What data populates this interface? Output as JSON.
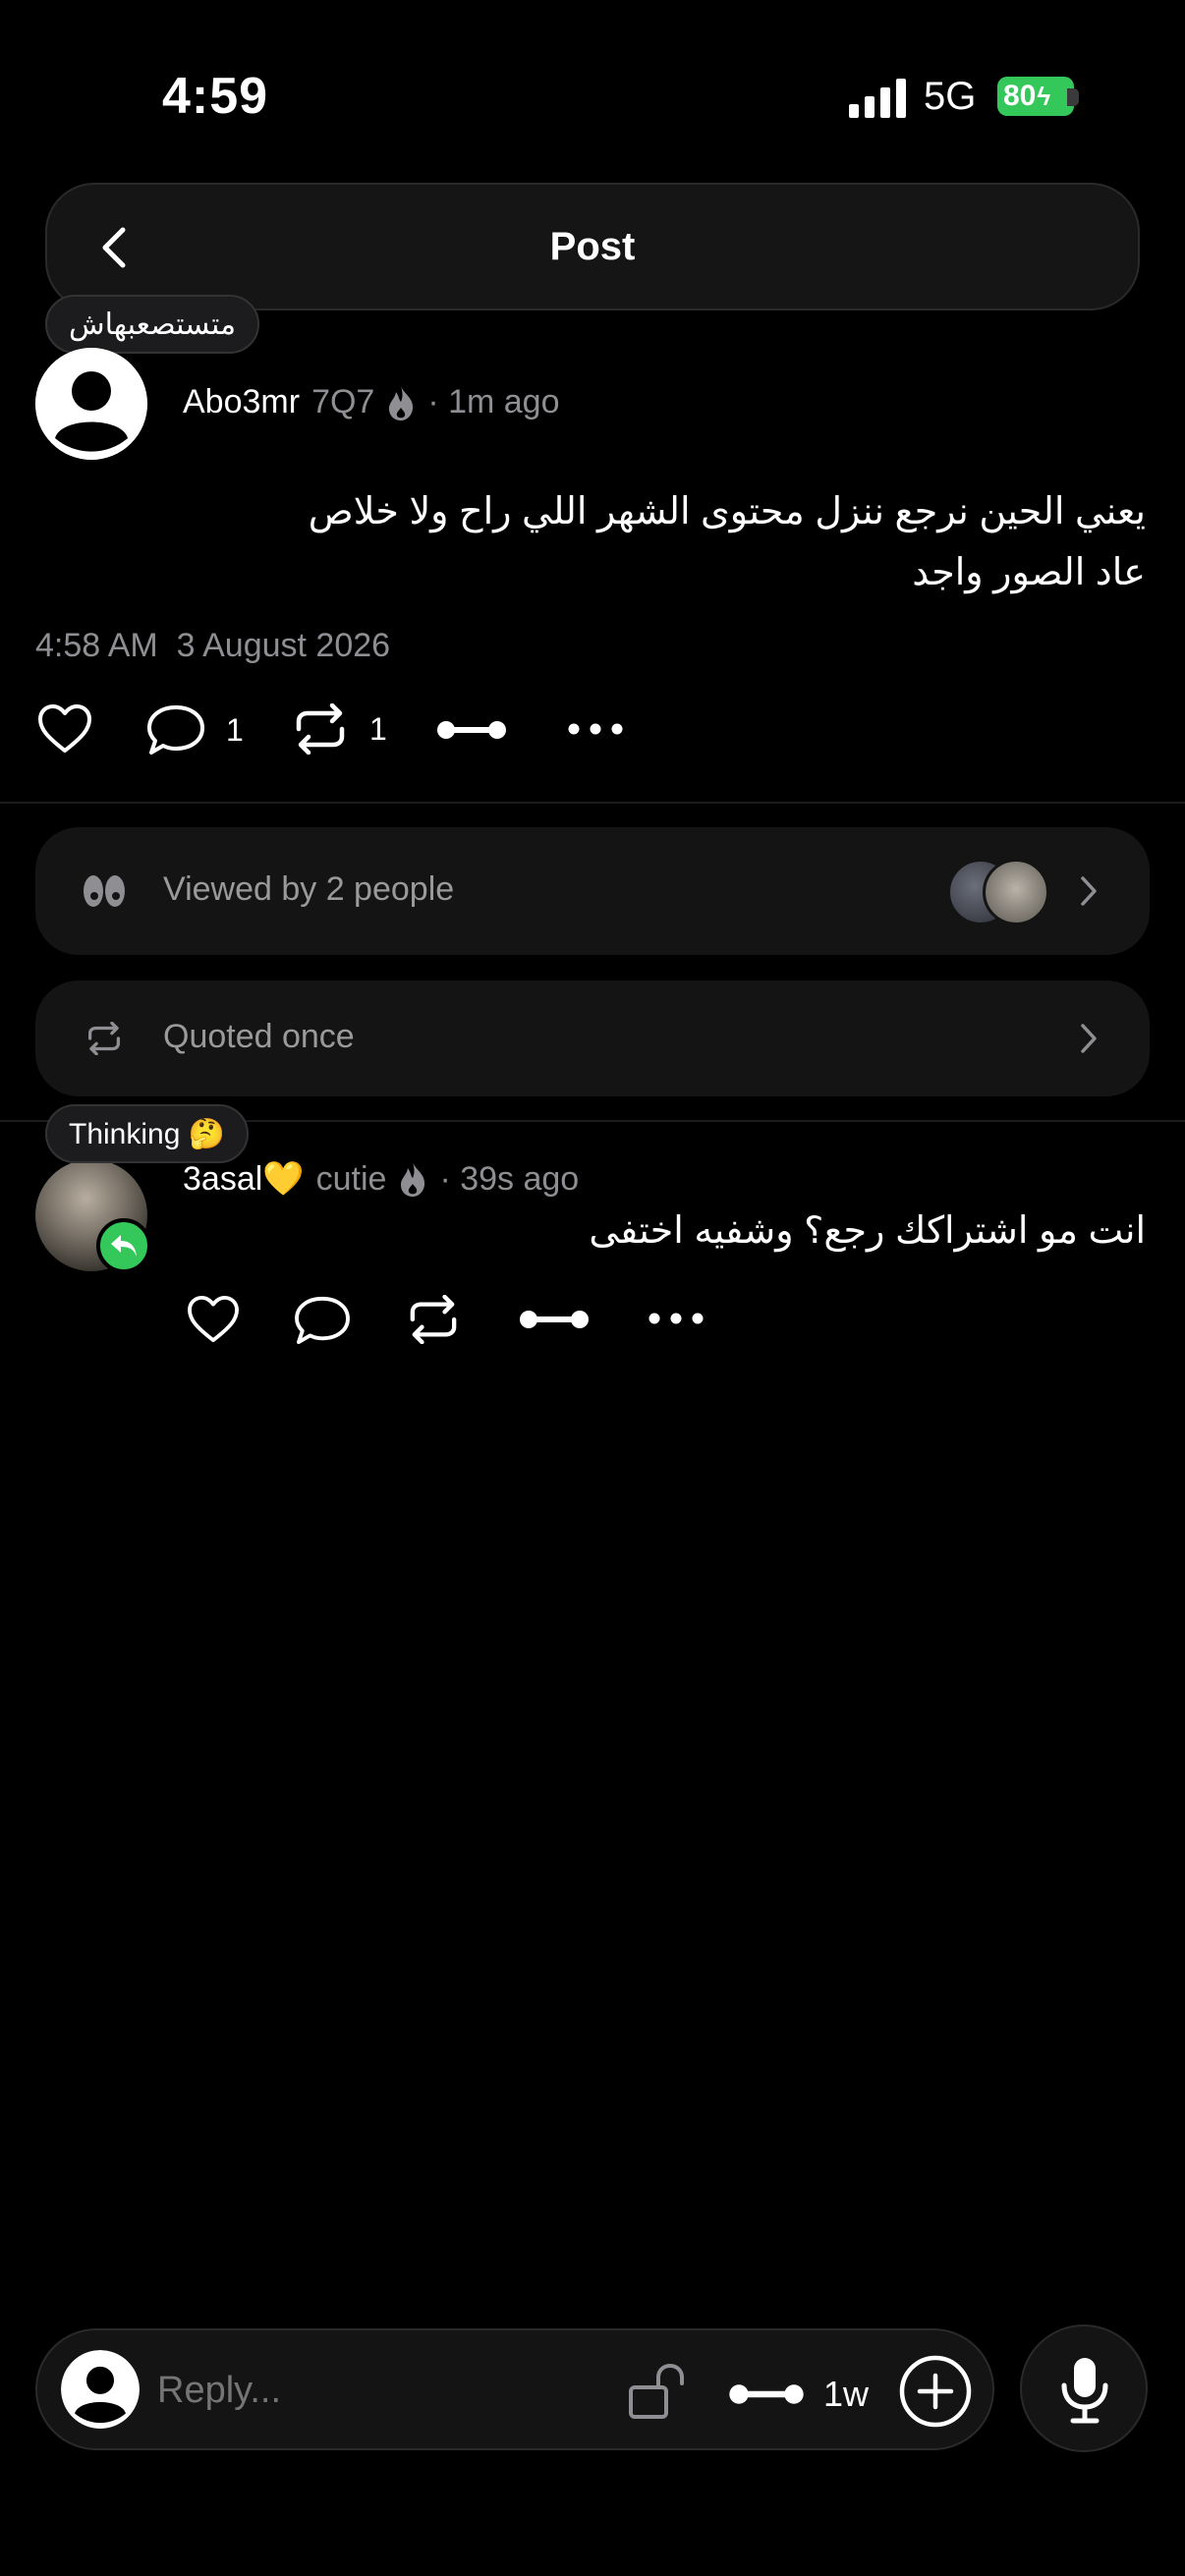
{
  "status_bar": {
    "time": "4:59",
    "network": "5G",
    "battery": "80"
  },
  "header": {
    "title": "Post"
  },
  "post": {
    "note": "متستصعبهاش",
    "author": "Abo3mr",
    "author_tag": "7Q7",
    "time_ago": "· 1m ago",
    "text_line1": "يعني الحين نرجع ننزل محتوى الشهر اللي راح ولا خلاص",
    "text_line2": "عاد الصور واجد",
    "timestamp": "4:58 AM  3 August 2026",
    "reply_count": "1",
    "repost_count": "1"
  },
  "viewed": {
    "label": "Viewed by 2 people"
  },
  "quoted": {
    "label": "Quoted once"
  },
  "reply": {
    "note": "Thinking 🤔",
    "author": "3asal💛",
    "author_tag": "cutie",
    "time_ago": "· 39s ago",
    "text": "انت مو اشتراكك رجع؟ وشفيه اختفى"
  },
  "composer": {
    "placeholder": "Reply...",
    "expiry": "1w"
  },
  "colors": {
    "accent_green": "#34c759",
    "background": "#000000",
    "card": "#141414"
  }
}
